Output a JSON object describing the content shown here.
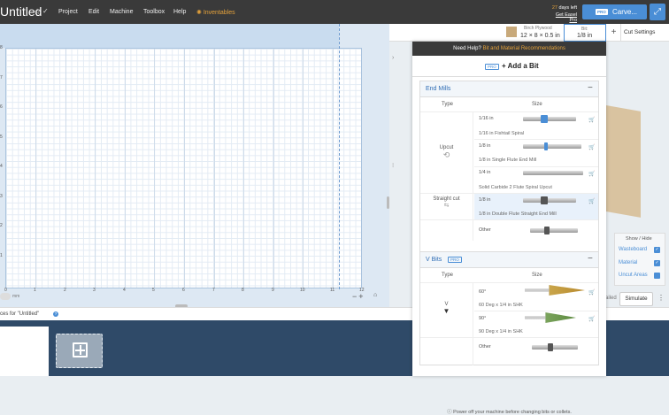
{
  "header": {
    "title": "Untitled",
    "menu": [
      "Project",
      "Edit",
      "Machine",
      "Toolbox",
      "Help"
    ],
    "inventables": "Inventables",
    "trial_days": "27",
    "trial_text": "days left",
    "get_pro": "Get Easel Pro",
    "carve_pro": "PRO",
    "carve_label": "Carve..."
  },
  "subbar": {
    "material_name": "Birch Plywood",
    "material_dims": "12 × 8 × 0.5 in",
    "bit_label": "Bit:",
    "bit_value": "1/8 in",
    "cut_settings": "Cut Settings"
  },
  "canvas": {
    "x_ticks": [
      "0",
      "1",
      "2",
      "3",
      "4",
      "5",
      "6",
      "7",
      "8",
      "9",
      "10",
      "11",
      "12"
    ],
    "y_ticks": [
      "8",
      "7",
      "6",
      "5",
      "4",
      "3",
      "2",
      "1"
    ],
    "unit": "mm"
  },
  "pieces_label": "ces for \"Untitled\"",
  "panel": {
    "help_text": "Need Help?",
    "help_link": "Bit and Material Recommendations",
    "add_pro": "PRO",
    "add_label": "+ Add a Bit",
    "col_type": "Type",
    "col_size": "Size",
    "end_mills": {
      "title": "End Mills",
      "upcut": "Upcut",
      "straight": "Straight cut",
      "bits": [
        {
          "size": "1/16 in",
          "desc": "1/16 in Fishtail Spiral"
        },
        {
          "size": "1/8 in",
          "desc": "1/8 in Single Flute End Mill"
        },
        {
          "size": "1/4 in",
          "desc": "Solid Carbide 2 Flute Spiral Upcut"
        },
        {
          "size": "1/8 in",
          "desc": "1/8 in Double Flute Straight End Mill"
        },
        {
          "size": "Other",
          "desc": ""
        }
      ]
    },
    "v_bits": {
      "title": "V Bits",
      "pro": "PRO",
      "type": "V",
      "bits": [
        {
          "size": "60°",
          "desc": "60 Deg x 1/4 in SHK"
        },
        {
          "size": "90°",
          "desc": "90 Deg x 1/4 in SHK"
        },
        {
          "size": "Other",
          "desc": ""
        }
      ]
    },
    "footer": "Power off your machine before changing bits or collets."
  },
  "show_hide": {
    "title": "Show / Hide",
    "items": [
      "Wasteboard",
      "Material",
      "Uncut Areas"
    ]
  },
  "failed": "ailed",
  "simulate": "Simulate",
  "colors": {
    "accent": "#4a8ed6",
    "brand": "#e6a33b",
    "topbar": "#3a3a3a"
  }
}
